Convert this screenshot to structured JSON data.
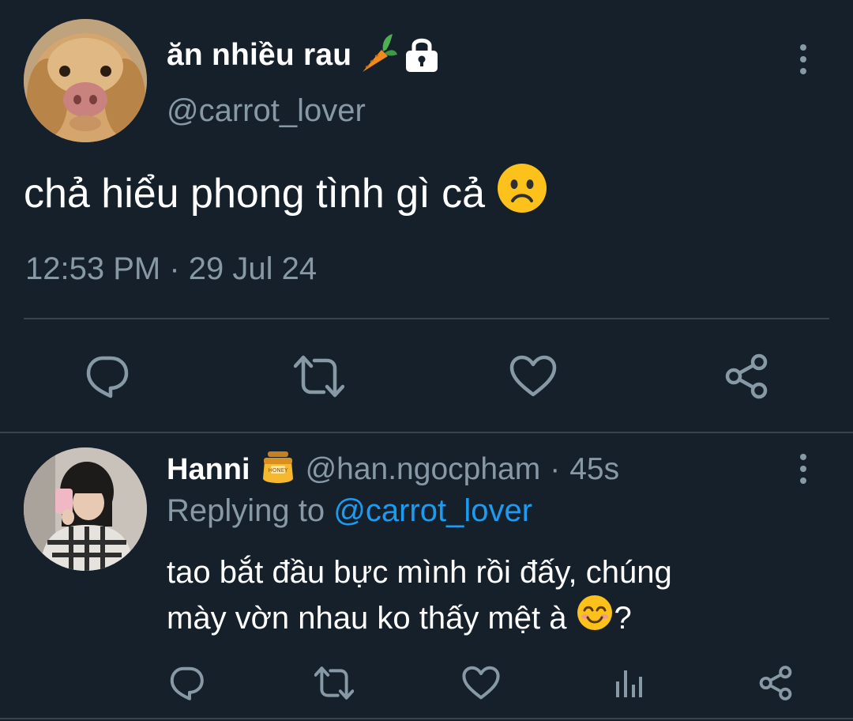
{
  "tweet": {
    "display_name": "ăn nhiều rau",
    "handle": "@carrot_lover",
    "text": "chả hiểu phong tình gì cả",
    "timestamp": "12:53 PM · 29 Jul 24",
    "icons": {
      "name_emoji": "carrot-icon",
      "protected": "lock-icon",
      "text_emoji": "frowning-face-icon",
      "more": "more-vertical-icon"
    },
    "actions": [
      "reply-icon",
      "retweet-icon",
      "like-icon",
      "share-icon"
    ]
  },
  "reply": {
    "display_name": "Hanni",
    "handle": "@han.ngocpham",
    "separator": "·",
    "time": "45s",
    "replying_prefix": "Replying to",
    "replying_mention": "@carrot_lover",
    "text_line1": "tao bắt đầu bực mình rồi đấy, chúng",
    "text_line2": "mày vờn nhau ko thấy mệt à",
    "text_end": "?",
    "icons": {
      "name_emoji": "honey-pot-icon",
      "text_emoji": "smiling-face-icon",
      "more": "more-vertical-icon"
    },
    "actions": [
      "reply-icon",
      "retweet-icon",
      "like-icon",
      "analytics-icon",
      "share-icon"
    ]
  },
  "colors": {
    "background": "#15202b",
    "primary_text": "#ffffff",
    "secondary_text": "#8899a6",
    "divider": "#38444d",
    "link": "#1d9bf0"
  }
}
